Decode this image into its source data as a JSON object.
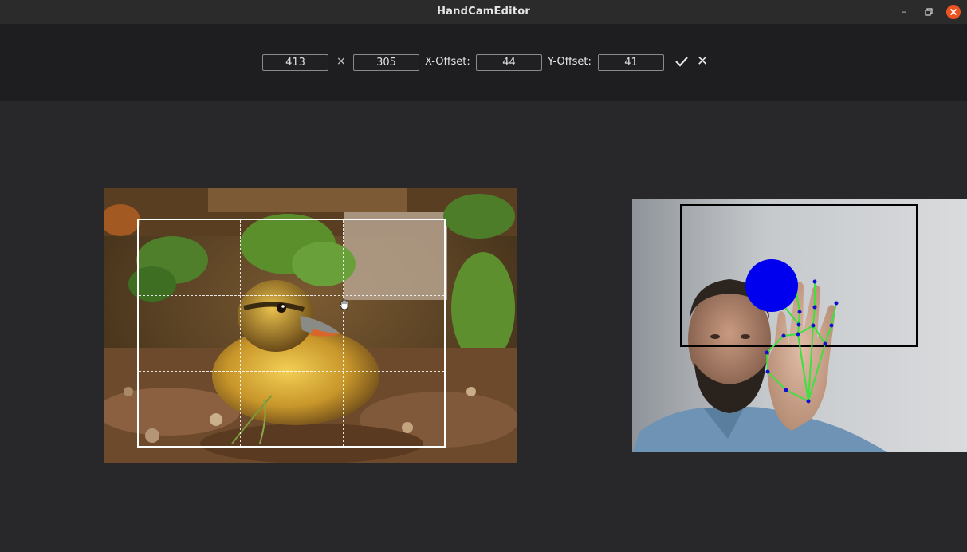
{
  "window": {
    "title": "HandCamEditor",
    "minimize_icon": "minimize-icon",
    "maximize_icon": "restore-icon",
    "close_icon": "close-icon"
  },
  "toolbar": {
    "width_value": "413",
    "times_symbol": "×",
    "height_value": "305",
    "x_offset_label": "X-Offset:",
    "x_offset_value": "44",
    "y_offset_label": "Y-Offset:",
    "y_offset_value": "41",
    "confirm_icon": "checkmark-icon",
    "cancel_icon": "close-icon",
    "cancel_glyph": "✕"
  },
  "colors": {
    "background": "#28282b",
    "toolbar": "#1e1e20",
    "close_button": "#e95420",
    "crop_frame": "#ffffff",
    "hand_skeleton": "#3fe03f",
    "hand_points": "#1010d0",
    "pointer_circle": "#0000ee"
  },
  "canvas": {
    "image_subject": "duckling photo",
    "cursor_icon": "grab-hand-icon"
  },
  "camera": {
    "feed": "webcam preview with hand tracking",
    "pointer_icon": "pointer-circle"
  }
}
